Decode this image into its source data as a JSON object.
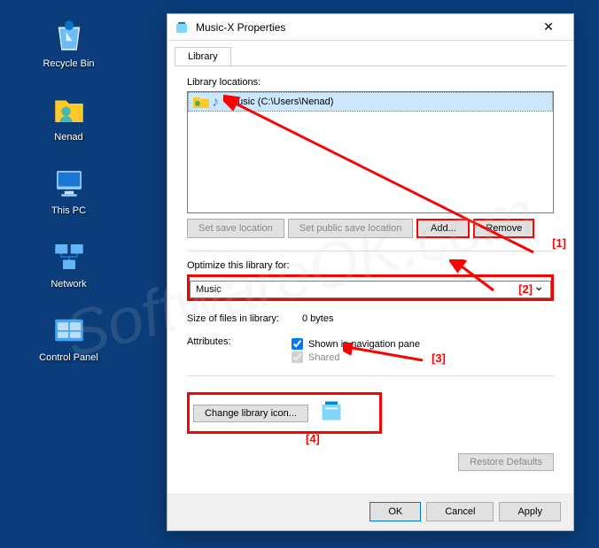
{
  "desktop": {
    "icons": [
      {
        "label": "Recycle Bin",
        "icon": "recycle"
      },
      {
        "label": "Nenad",
        "icon": "user"
      },
      {
        "label": "This PC",
        "icon": "pc"
      },
      {
        "label": "Network",
        "icon": "network"
      },
      {
        "label": "Control Panel",
        "icon": "control"
      }
    ]
  },
  "dialog": {
    "title": "Music-X Properties",
    "tab": "Library",
    "locations_label": "Library locations:",
    "location_item": "Music (C:\\Users\\Nenad)",
    "btn_set_save": "Set save location",
    "btn_set_public": "Set public save location",
    "btn_add": "Add...",
    "btn_remove": "Remove",
    "optimize_label": "Optimize this library for:",
    "optimize_value": "Music",
    "size_label": "Size of files in library:",
    "size_value": "0 bytes",
    "attributes_label": "Attributes:",
    "attr_nav": "Shown in navigation pane",
    "attr_shared": "Shared",
    "btn_change_icon": "Change library icon...",
    "btn_restore": "Restore Defaults",
    "btn_ok": "OK",
    "btn_cancel": "Cancel",
    "btn_apply": "Apply"
  },
  "annotations": {
    "a1": "[1]",
    "a2": "[2]",
    "a3": "[3]",
    "a4": "[4]"
  },
  "watermark": "SoftwareOK.com"
}
